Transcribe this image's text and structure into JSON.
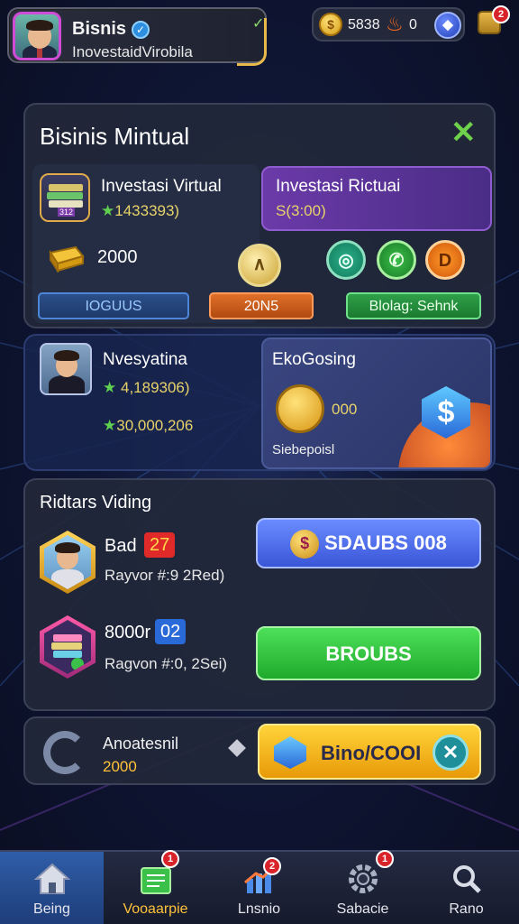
{
  "profile": {
    "name": "Bisnis",
    "subtitle": "InovestaidVirobila"
  },
  "currency": {
    "coin_value": "5838",
    "fire_value": "0",
    "bag_badge": "2"
  },
  "main_panel": {
    "title": "Bisinis Mintual",
    "left_card": {
      "title": "Investasi Virtual",
      "stat": "1433393)",
      "stack_label": "312"
    },
    "right_card": {
      "title": "Investasi Rictuai",
      "value": "S(3:00)"
    },
    "gold_value": "2000",
    "buttons": {
      "blue_tag": "IOGUUS",
      "orange_tag": "20N5",
      "green_tag": "Blolag: Sehnk"
    },
    "round_buttons": [
      "coin",
      "target",
      "call",
      "d"
    ]
  },
  "row2": {
    "player": {
      "name": "Nvesyatina",
      "stat1": "4,189306)",
      "stat2": "30,000,206"
    },
    "eko_card": {
      "title": "EkoGosing",
      "coin_value": "000",
      "footer": "Siebepoisl"
    }
  },
  "bid_panel": {
    "title": "Ridtars Viding",
    "rows": [
      {
        "name": "Bad",
        "badge": "27",
        "detail": "Rayvor #:9 2Red)",
        "button": "SDAUBS 008"
      },
      {
        "name": "8000r",
        "badge": "02",
        "detail": "Ragvon #:0, 2Sei)",
        "button": "BROUBS"
      }
    ]
  },
  "footer_panel": {
    "label": "Anoatesnil",
    "value": "2000",
    "button": "Bino/COOI"
  },
  "bottom_nav": [
    {
      "label": "Being",
      "icon": "home-icon",
      "badge": ""
    },
    {
      "label": "Vooaarpie",
      "icon": "ledger-icon",
      "badge": "1"
    },
    {
      "label": "Lnsnio",
      "icon": "chart-icon",
      "badge": "2"
    },
    {
      "label": "Sabacie",
      "icon": "gear-icon",
      "badge": "1"
    },
    {
      "label": "Rano",
      "icon": "search-icon",
      "badge": ""
    }
  ],
  "colors": {
    "accent_green": "#5fd04f",
    "accent_gold": "#ffd43a",
    "accent_blue": "#4a6cf0",
    "accent_purple": "#6b3aa8"
  }
}
